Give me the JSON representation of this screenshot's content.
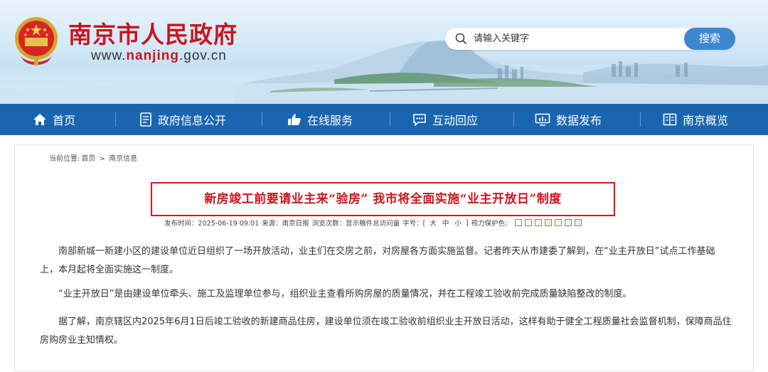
{
  "header": {
    "site_title": "南京市人民政府",
    "site_url_prefix": "www.",
    "site_url_brand": "nanjing",
    "site_url_suffix": ".gov.cn",
    "brand_color": "#c8161d"
  },
  "search": {
    "placeholder": "请输入关键字",
    "button_label": "搜索",
    "accent": "#3f86d0"
  },
  "nav": {
    "background": "#1a65b0",
    "items": [
      {
        "label": "首页",
        "icon": "home-icon"
      },
      {
        "label": "政府信息公开",
        "icon": "document-icon"
      },
      {
        "label": "在线服务",
        "icon": "thumbs-up-icon"
      },
      {
        "label": "互动回应",
        "icon": "chat-icon"
      },
      {
        "label": "数据发布",
        "icon": "monitor-chart-icon"
      },
      {
        "label": "南京概览",
        "icon": "book-icon"
      }
    ]
  },
  "breadcrumb": {
    "prefix": "当前位置:",
    "home": "首页",
    "separator": ">",
    "current": "南京信息"
  },
  "article": {
    "title": "新房竣工前要请业主来“验房” 我市将全面实施“业主开放日”制度",
    "meta": {
      "publish_time": "发布时间：2025-06-19 09:01",
      "source": "来源：南京日报",
      "views": "浏览次数：显示稿件总访问量",
      "font_size_label": "字号：[",
      "font_large": "大",
      "font_medium": "中",
      "font_small": "小",
      "font_close": "]",
      "eye_care_label": "视力保护色：",
      "eye_care_colors": [
        "#ffffff",
        "#fafbe6",
        "#fff2e2",
        "#fde6e0",
        "#f3ffe1",
        "#dafaef",
        "#eaeaef"
      ]
    },
    "paragraphs": [
      "南部新城一新建小区的建设单位近日组织了一场开放活动，业主们在交房之前，对房屋各方面实施监督。记者昨天从市建委了解到，在“业主开放日”试点工作基础上，本月起将全面实施这一制度。",
      "“业主开放日”是由建设单位牵头、施工及监理单位参与，组织业主查看所购房屋的质量情况，并在工程竣工验收前完成质量缺陷整改的制度。",
      "据了解，南京辖区内2025年6月1日后竣工验收的新建商品住房，建设单位须在竣工验收前组织业主开放日活动，这样有助于健全工程质量社会监督机制，保障商品住房购房业主知情权。"
    ]
  }
}
